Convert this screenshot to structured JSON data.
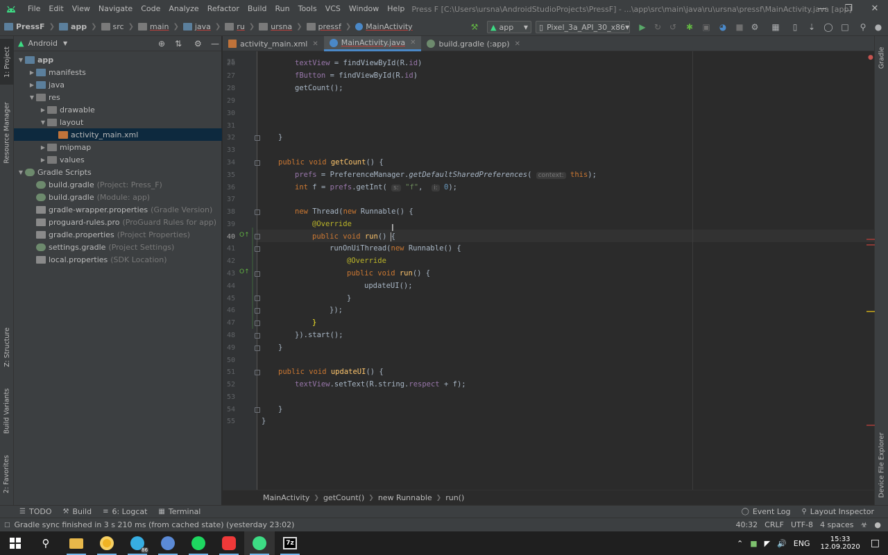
{
  "titlebar": {
    "menu": [
      "File",
      "Edit",
      "View",
      "Navigate",
      "Code",
      "Analyze",
      "Refactor",
      "Build",
      "Run",
      "Tools",
      "VCS",
      "Window",
      "Help"
    ],
    "title": "Press F [C:\\Users\\ursna\\AndroidStudioProjects\\PressF] - ...\\app\\src\\main\\java\\ru\\ursna\\pressf\\MainActivity.java [app]"
  },
  "navbar": {
    "crumbs": [
      "PressF",
      "app",
      "src",
      "main",
      "java",
      "ru",
      "ursna",
      "pressf",
      "MainActivity"
    ],
    "run_config": "app",
    "device": "Pixel_3a_API_30_x86"
  },
  "project": {
    "view": "Android",
    "tree": [
      {
        "label": "app",
        "hint": ""
      },
      {
        "label": "manifests",
        "hint": ""
      },
      {
        "label": "java",
        "hint": ""
      },
      {
        "label": "res",
        "hint": ""
      },
      {
        "label": "drawable",
        "hint": ""
      },
      {
        "label": "layout",
        "hint": ""
      },
      {
        "label": "activity_main.xml",
        "hint": ""
      },
      {
        "label": "mipmap",
        "hint": ""
      },
      {
        "label": "values",
        "hint": ""
      },
      {
        "label": "Gradle Scripts",
        "hint": ""
      },
      {
        "label": "build.gradle",
        "hint": "(Project: Press_F)"
      },
      {
        "label": "build.gradle",
        "hint": "(Module: app)"
      },
      {
        "label": "gradle-wrapper.properties",
        "hint": "(Gradle Version)"
      },
      {
        "label": "proguard-rules.pro",
        "hint": "(ProGuard Rules for app)"
      },
      {
        "label": "gradle.properties",
        "hint": "(Project Properties)"
      },
      {
        "label": "settings.gradle",
        "hint": "(Project Settings)"
      },
      {
        "label": "local.properties",
        "hint": "(SDK Location)"
      }
    ]
  },
  "side_tabs": {
    "left": [
      "1: Project",
      "Resource Manager",
      "Z: Structure",
      "Build Variants",
      "2: Favorites"
    ],
    "right": [
      "Gradle",
      "Device File Explorer"
    ]
  },
  "tabs": [
    "activity_main.xml",
    "MainActivity.java",
    "build.gradle (:app)"
  ],
  "code": {
    "line_numbers": [
      "25",
      "26",
      "27",
      "28",
      "29",
      "30",
      "31",
      "32",
      "33",
      "34",
      "35",
      "36",
      "37",
      "38",
      "39",
      "40",
      "41",
      "42",
      "43",
      "44",
      "45",
      "46",
      "47",
      "48",
      "49",
      "50",
      "51",
      "52",
      "53",
      "54",
      "55"
    ],
    "l26a": "textView",
    "l26b": " = findViewById(R.",
    "l26c": "id",
    "l26d": ")",
    "l27a": "fButton",
    "l27b": " = findViewById(R.",
    "l27c": "id",
    "l27d": ")",
    "l28": "getCount();",
    "l32": "}",
    "l34a": "public void ",
    "l34b": "getCount",
    "l34c": "() {",
    "l35a": "prefs",
    "l35b": " = PreferenceManager.",
    "l35c": "getDefaultSharedPreferences",
    "l35d": "( ",
    "l35e": "context:",
    "l35f": " this",
    "l35g": ");",
    "l36a": "int ",
    "l36b": "f",
    "l36c": " = ",
    "l36d": "prefs",
    "l36e": ".getInt( ",
    "l36f": "s:",
    "l36g": " \"f\"",
    "l36h": ",  ",
    "l36i": "i:",
    "l36j": " 0",
    "l36k": ");",
    "l38a": "new ",
    "l38b": "Thread(",
    "l38c": "new ",
    "l38d": "Runnable() {",
    "l39": "@Override",
    "l40a": "public void ",
    "l40b": "run",
    "l40c": "() {",
    "l41a": "runOnUiThread(",
    "l41b": "new ",
    "l41c": "Runnable() {",
    "l42": "@Override",
    "l43a": "public void ",
    "l43b": "run",
    "l43c": "() {",
    "l44": "updateUI();",
    "l45": "}",
    "l46": "});",
    "l47": "}",
    "l48": "}).start();",
    "l49": "}",
    "l51a": "public void ",
    "l51b": "updateUI",
    "l51c": "() {",
    "l52a": "textView",
    "l52b": ".setText(R.string.",
    "l52c": "respect",
    "l52d": " + ",
    "l52e": "f",
    "l52f": ");",
    "l54": "}",
    "l55": "}"
  },
  "breadcrumb": [
    "MainActivity",
    "getCount()",
    "new Runnable",
    "run()"
  ],
  "bottom_tools": [
    "TODO",
    "Build",
    "6: Logcat",
    "Terminal"
  ],
  "bottom_right_tools": [
    "Event Log",
    "Layout Inspector"
  ],
  "status": {
    "message": "Gradle sync finished in 3 s 210 ms (from cached state) (yesterday 23:02)",
    "position": "40:32",
    "line_sep": "CRLF",
    "encoding": "UTF-8",
    "indent": "4 spaces"
  },
  "taskbar": {
    "time": "15:33",
    "date": "12.09.2020",
    "lang": "ENG",
    "telegram_badge": "86"
  }
}
